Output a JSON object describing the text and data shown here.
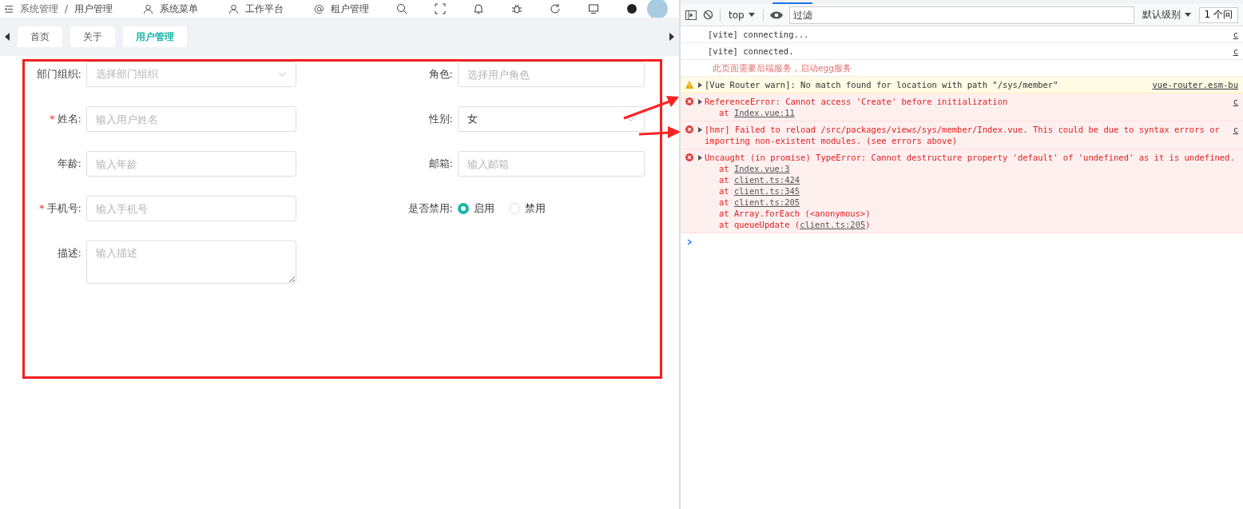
{
  "header": {
    "breadcrumb": [
      "系统管理",
      "用户管理"
    ],
    "breadcrumb_separator": "/",
    "menu": [
      {
        "label": "系统菜单"
      },
      {
        "label": "工作平台"
      },
      {
        "label": "租户管理"
      }
    ]
  },
  "tabs": [
    {
      "label": "首页",
      "selected": false
    },
    {
      "label": "关于",
      "selected": false
    },
    {
      "label": "用户管理",
      "selected": true
    }
  ],
  "form": {
    "fields": [
      {
        "kind": "select",
        "label": "部门组织:",
        "placeholder": "选择部门组织"
      },
      {
        "kind": "input",
        "label": "角色:",
        "placeholder": "选择用户角色"
      },
      {
        "kind": "input",
        "required_mark": "*",
        "label": "姓名:",
        "placeholder": "输入用户姓名"
      },
      {
        "kind": "select",
        "label": "性别:",
        "value": "女"
      },
      {
        "kind": "input",
        "label": "年龄:",
        "placeholder": "输入年龄"
      },
      {
        "kind": "input",
        "label": "邮箱:",
        "placeholder": "输入邮箱"
      },
      {
        "kind": "input",
        "required_mark": "*",
        "label": "手机号:",
        "placeholder": "输入手机号"
      },
      {
        "kind": "radio",
        "label": "是否禁用:",
        "options": [
          {
            "label": "启用",
            "selected": true
          },
          {
            "label": "禁用",
            "selected": false
          }
        ]
      },
      {
        "kind": "textarea",
        "label": "描述:",
        "placeholder": "输入描述"
      }
    ]
  },
  "devtools": {
    "context": "top",
    "filter": {
      "placeholder": "过滤"
    },
    "level": "默认级别",
    "issues": "1 个问",
    "messages": [
      {
        "kind": "log",
        "text": "[vite] connecting...",
        "source": "c"
      },
      {
        "kind": "log",
        "text": "[vite] connected.",
        "source": "c"
      },
      {
        "kind": "info",
        "text": "此页面需要后端服务，启动egg服务"
      },
      {
        "kind": "warning",
        "text": "[Vue Router warn]: No match found for location with path \"/sys/member\"",
        "source": "vue-router.esm-bu"
      },
      {
        "kind": "error",
        "text": "ReferenceError: Cannot access 'Create' before initialization",
        "source": "c",
        "stack": [
          {
            "prefix": "at ",
            "link": "Index.vue:11"
          }
        ]
      },
      {
        "kind": "error",
        "text": "[hmr] Failed to reload /src/packages/views/sys/member/Index.vue. This could be due to syntax errors or importing non-existent modules. (see errors above)",
        "source": "c"
      },
      {
        "kind": "error",
        "text": "Uncaught (in promise) TypeError: Cannot destructure property 'default' of 'undefined' as it is undefined.",
        "stack": [
          {
            "prefix": "at ",
            "link": "Index.vue:3"
          },
          {
            "prefix": "at ",
            "link": "client.ts:424"
          },
          {
            "prefix": "at ",
            "link": "client.ts:345"
          },
          {
            "prefix": "at ",
            "link": "client.ts:205"
          },
          {
            "prefix": "at Array.forEach (<anonymous>)"
          },
          {
            "prefix": "at queueUpdate (",
            "link": "client.ts:205",
            "suffix": ")"
          }
        ]
      }
    ]
  }
}
